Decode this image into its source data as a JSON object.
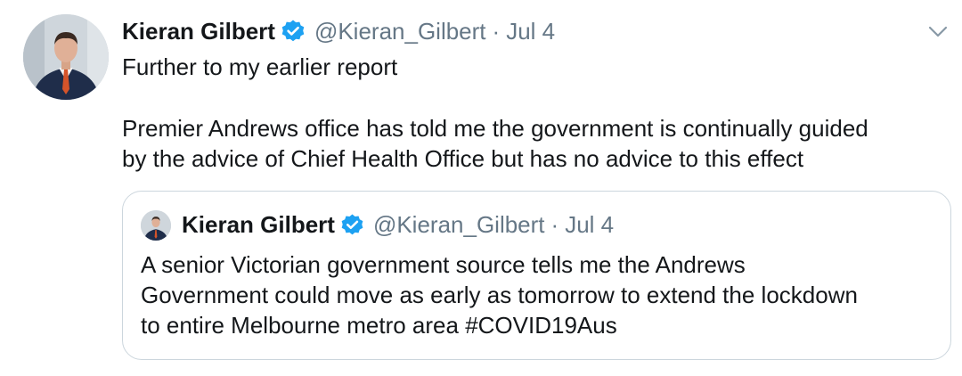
{
  "tweet": {
    "author_name": "Kieran Gilbert",
    "handle": "@Kieran_Gilbert",
    "separator": "·",
    "date": "Jul 4",
    "verified_icon": "verified-badge-icon",
    "menu_icon": "chevron-down-icon",
    "text_lines": [
      "Further to my earlier report",
      "Premier Andrews office has told me the government is continually guided",
      "by the advice of Chief Health Office but has no advice to this effect"
    ]
  },
  "quoted_tweet": {
    "author_name": "Kieran Gilbert",
    "handle": "@Kieran_Gilbert",
    "separator": "·",
    "date": "Jul 4",
    "text_lines": [
      "A senior Victorian government source tells me the Andrews",
      "Government could move as early as tomorrow to extend the lockdown",
      "to entire Melbourne metro area #COVID19Aus"
    ]
  },
  "colors": {
    "verified": "#1da1f2",
    "secondary_text": "#657786",
    "border": "#ccd6dd"
  }
}
